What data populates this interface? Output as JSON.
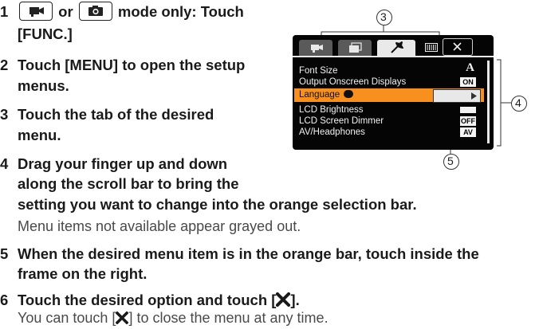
{
  "steps": [
    {
      "num": "1",
      "line1_pre": "",
      "line1_or": "or",
      "line1_post": "mode only: Touch",
      "line2": "[FUNC.]"
    },
    {
      "num": "2",
      "line1": "Touch [MENU] to open the setup",
      "line2": "menus."
    },
    {
      "num": "3",
      "line1": "Touch the tab of the desired",
      "line2": "menu."
    },
    {
      "num": "4",
      "line1": "Drag your finger up and down",
      "line2": "along the scroll bar to bring the",
      "line3": "setting you want to change into the orange selection bar.",
      "note": "Menu items not available appear grayed out."
    },
    {
      "num": "5",
      "line1": "When the desired menu item is in the orange bar, touch inside the",
      "line2": "frame on the right."
    },
    {
      "num": "6",
      "line1_pre": "Touch the desired option and touch [",
      "line1_post": "].",
      "note_pre": "You can touch [",
      "note_post": "] to close the menu at any time."
    }
  ],
  "callouts": {
    "c3": "3",
    "c4": "4",
    "c5": "5"
  },
  "lcd_menu": {
    "items": [
      {
        "label": "Font Size",
        "value": "A"
      },
      {
        "label": "Output Onscreen Displays",
        "value": "ON"
      },
      {
        "label": "Language",
        "value": ""
      },
      {
        "label": "LCD Brightness",
        "value": ""
      },
      {
        "label": "LCD Screen Dimmer",
        "value": "OFF"
      },
      {
        "label": "AV/Headphones",
        "value": "AV"
      }
    ],
    "selected_index": 2,
    "colors": {
      "selection": "#f7901e",
      "background": "#050505",
      "text": "#f2f2f2"
    }
  },
  "icons": [
    "movie-camera-icon",
    "photo-camera-icon",
    "wrench-icon",
    "memory-card-icon",
    "close-icon",
    "play-arrow-icon",
    "language-icon"
  ]
}
